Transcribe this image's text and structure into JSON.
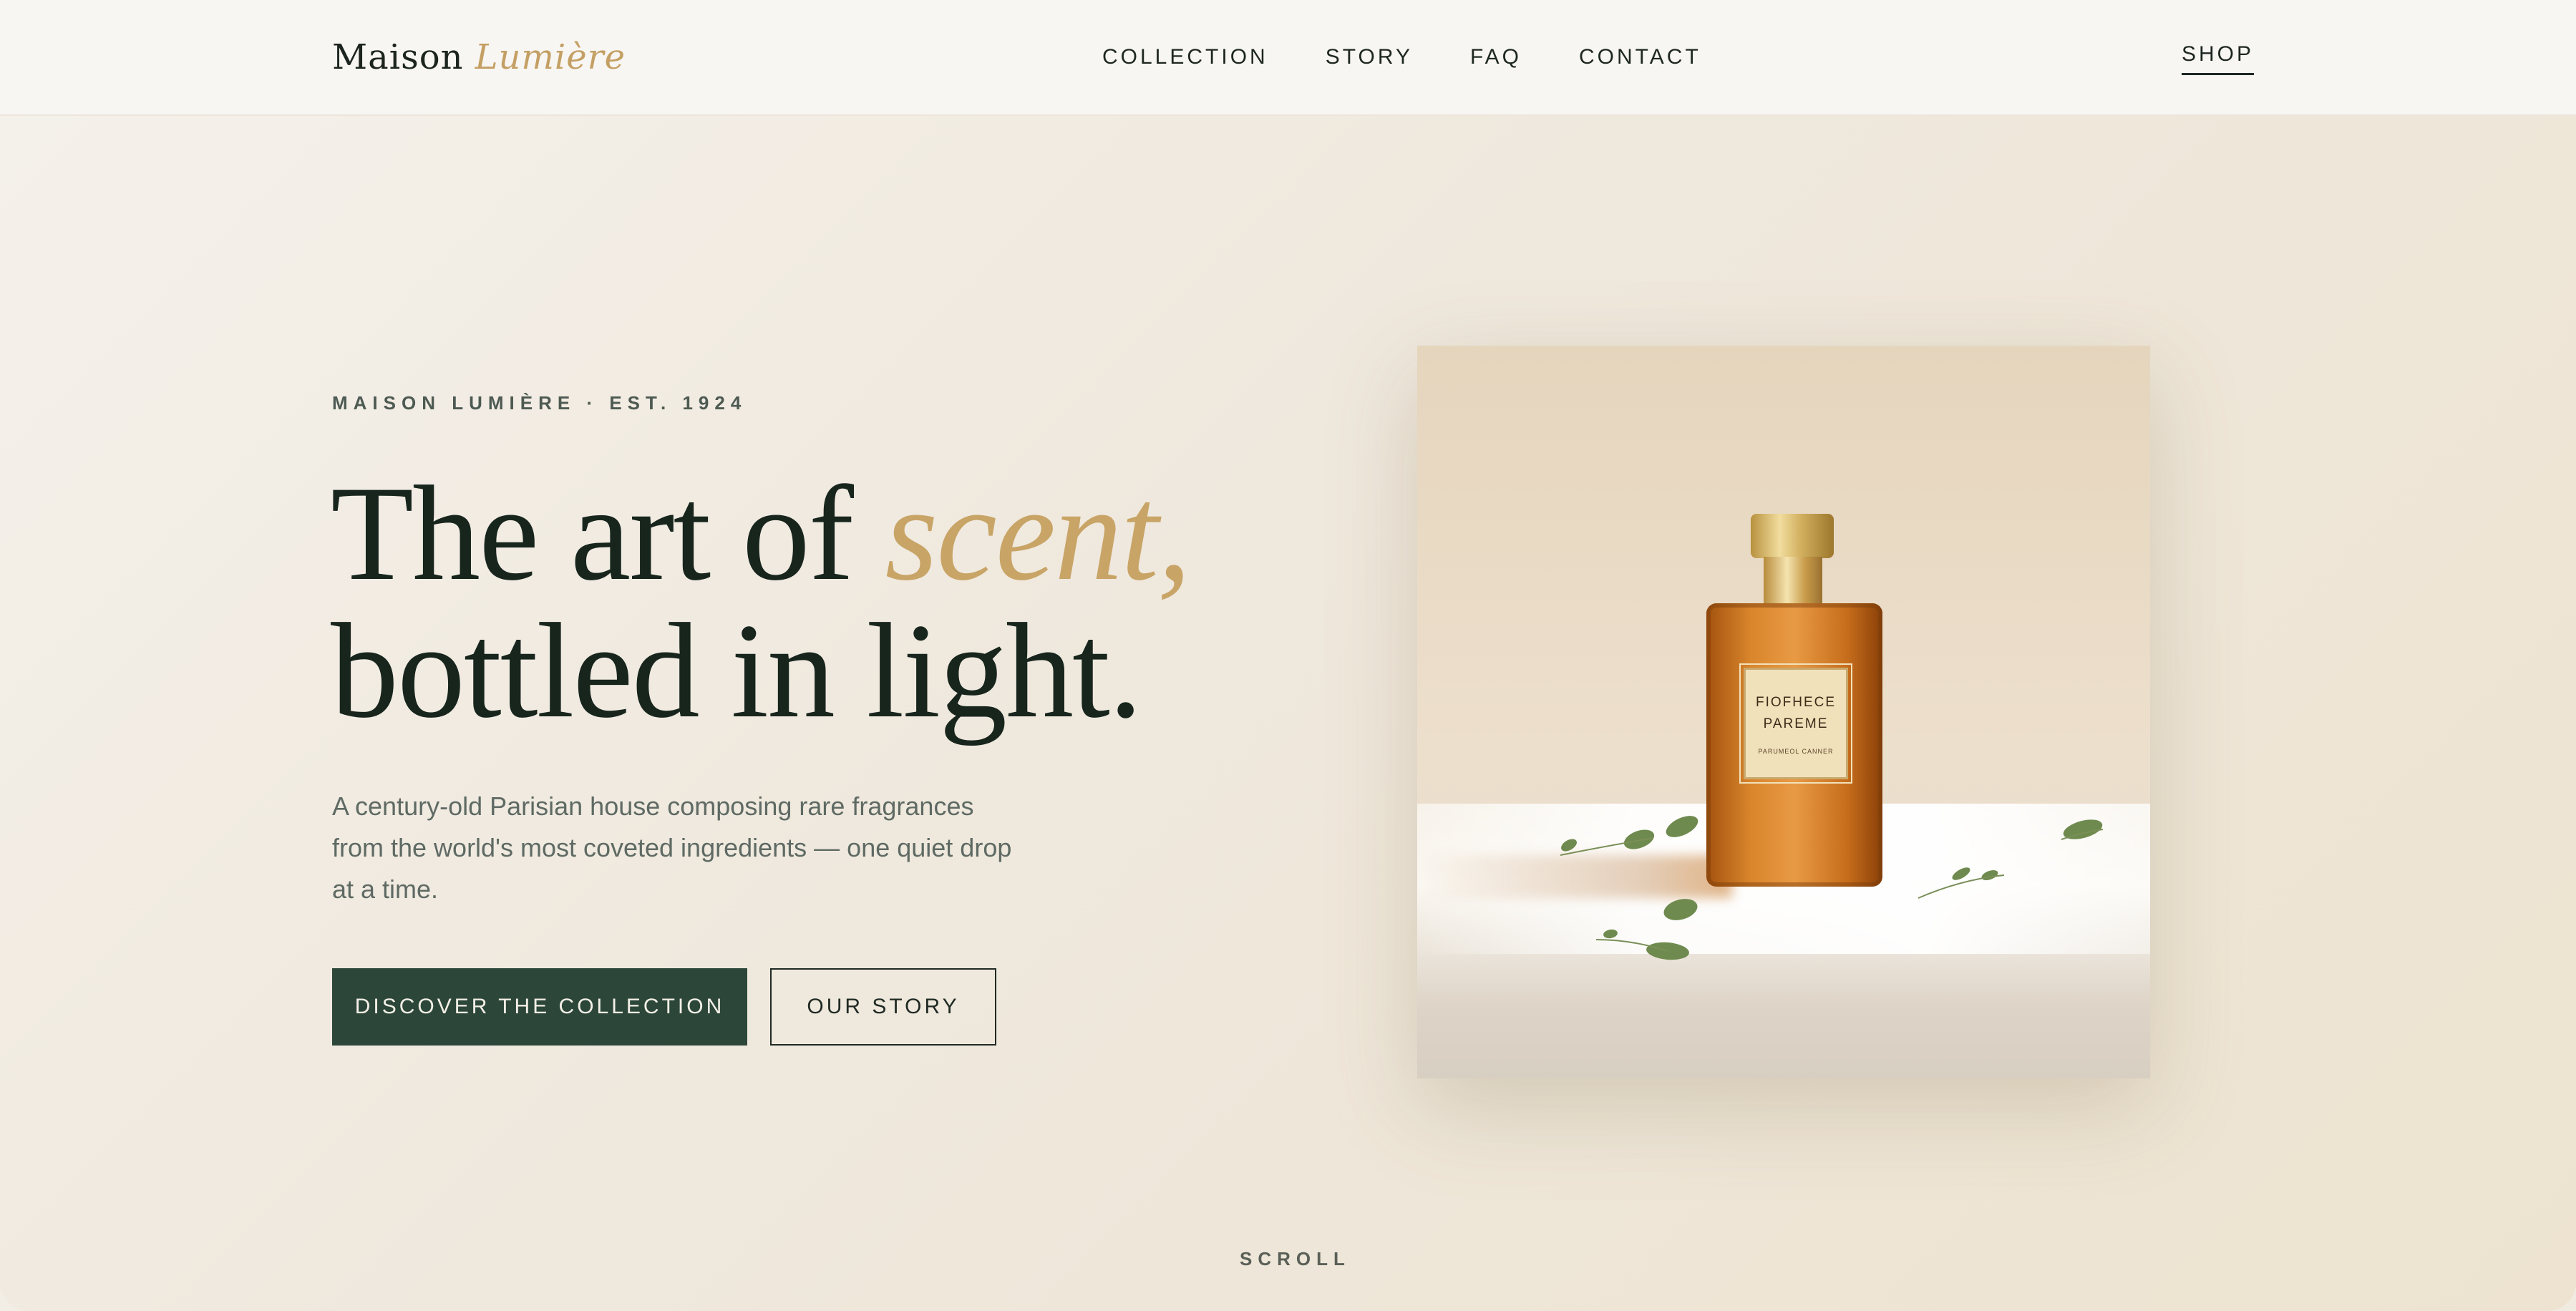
{
  "brand": {
    "name": "Maison",
    "accent": "Lumière"
  },
  "nav": {
    "links": [
      "COLLECTION",
      "STORY",
      "FAQ",
      "CONTACT"
    ],
    "shop": "SHOP"
  },
  "hero": {
    "eyebrow": "MAISON LUMIÈRE · EST. 1924",
    "headline_line1": "The art of",
    "headline_accent": "scent,",
    "headline_line2": "bottled in light.",
    "lede": "A century-old Parisian house composing rare fragrances from the world's most coveted ingredients — one quiet drop at a time.",
    "primary_cta": "DISCOVER THE COLLECTION",
    "secondary_cta": "OUR STORY"
  },
  "product": {
    "label_line1": "FIOFHECE",
    "label_line2": "PAREME",
    "label_small": "PARUMEOL CANNER"
  },
  "scroll": "SCROLL",
  "colors": {
    "accent": "#c8a466",
    "primary_button": "#2c4739",
    "ink": "#17251d"
  }
}
